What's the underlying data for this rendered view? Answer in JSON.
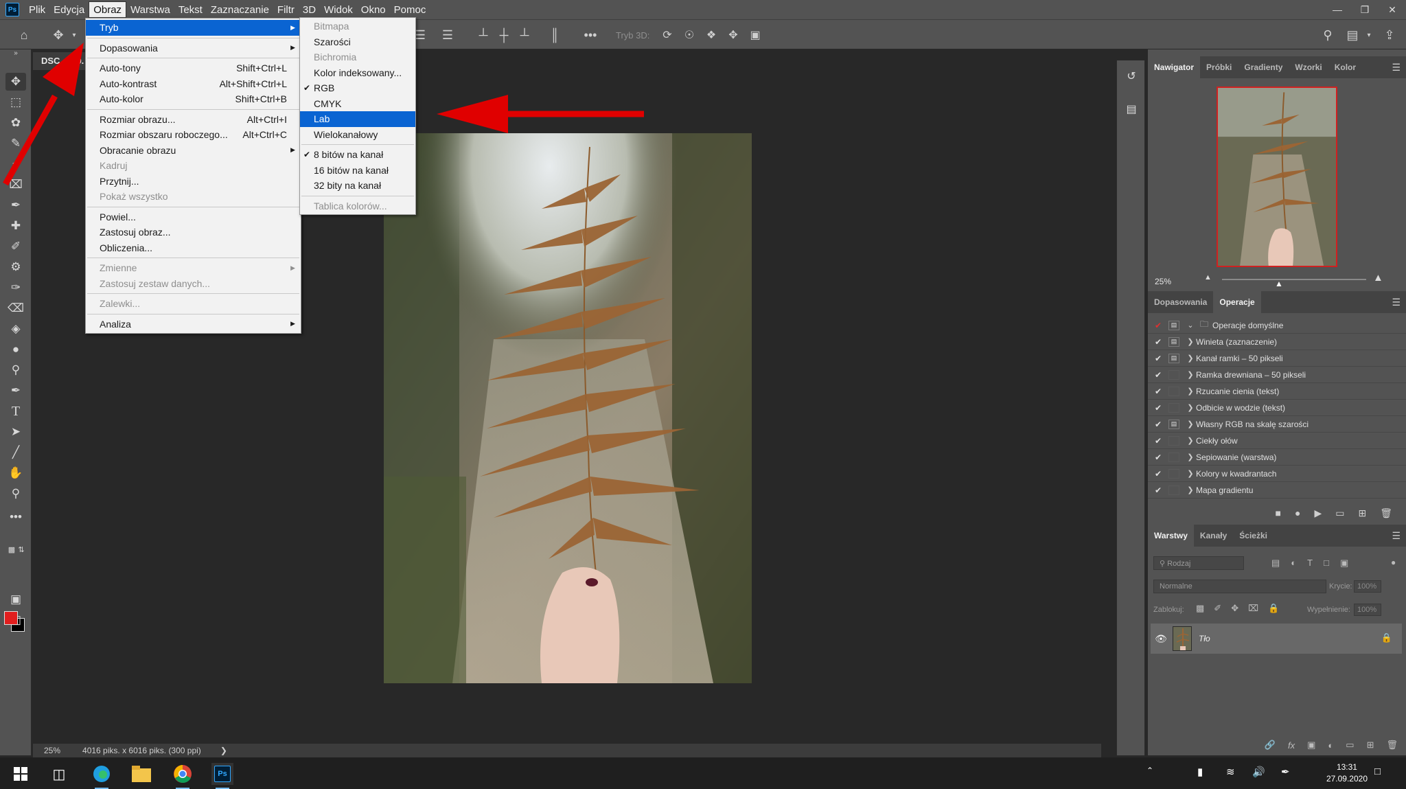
{
  "app": {
    "logo": "Ps",
    "menu": [
      "Plik",
      "Edycja",
      "Obraz",
      "Warstwa",
      "Tekst",
      "Zaznaczanie",
      "Filtr",
      "3D",
      "Widok",
      "Okno",
      "Pomoc"
    ],
    "active_menu": "Obraz"
  },
  "options_bar": {
    "mode_3d_label": "Tryb 3D:"
  },
  "document": {
    "tab_label": "DSC",
    "tab_label_tail": "9.",
    "zoom": "25%",
    "size_info": "4016 piks. x 6016 piks. (300 ppi)",
    "status_arrow": "❯"
  },
  "obraz_menu": {
    "items": [
      {
        "label": "Tryb",
        "highlight": true,
        "submenu": true
      },
      {
        "sep": true
      },
      {
        "label": "Dopasowania",
        "submenu": true
      },
      {
        "sep": true
      },
      {
        "label": "Auto-tony",
        "shortcut": "Shift+Ctrl+L"
      },
      {
        "label": "Auto-kontrast",
        "shortcut": "Alt+Shift+Ctrl+L"
      },
      {
        "label": "Auto-kolor",
        "shortcut": "Shift+Ctrl+B"
      },
      {
        "sep": true
      },
      {
        "label": "Rozmiar obrazu...",
        "shortcut": "Alt+Ctrl+I"
      },
      {
        "label": "Rozmiar obszaru roboczego...",
        "shortcut": "Alt+Ctrl+C"
      },
      {
        "label": "Obracanie obrazu",
        "submenu": true
      },
      {
        "label": "Kadruj",
        "disabled": true
      },
      {
        "label": "Przytnij..."
      },
      {
        "label": "Pokaż wszystko",
        "disabled": true
      },
      {
        "sep": true
      },
      {
        "label": "Powiel..."
      },
      {
        "label": "Zastosuj obraz..."
      },
      {
        "label": "Obliczenia..."
      },
      {
        "sep": true
      },
      {
        "label": "Zmienne",
        "disabled": true,
        "submenu": true
      },
      {
        "label": "Zastosuj zestaw danych...",
        "disabled": true
      },
      {
        "sep": true
      },
      {
        "label": "Zalewki...",
        "disabled": true
      },
      {
        "sep": true
      },
      {
        "label": "Analiza",
        "submenu": true
      }
    ]
  },
  "tryb_menu": {
    "items": [
      {
        "label": "Bitmapa",
        "disabled": true
      },
      {
        "label": "Szarości"
      },
      {
        "label": "Bichromia",
        "disabled": true
      },
      {
        "label": "Kolor indeksowany..."
      },
      {
        "label": "RGB",
        "checked": true
      },
      {
        "label": "CMYK"
      },
      {
        "label": "Lab",
        "highlight": true
      },
      {
        "label": "Wielokanałowy"
      },
      {
        "sep": true
      },
      {
        "label": "8 bitów na kanał",
        "checked": true
      },
      {
        "label": "16 bitów na kanał"
      },
      {
        "label": "32 bity na kanał"
      },
      {
        "sep": true
      },
      {
        "label": "Tablica kolorów...",
        "disabled": true
      }
    ]
  },
  "navigator": {
    "tabs": [
      "Nawigator",
      "Próbki",
      "Gradienty",
      "Wzorki",
      "Kolor"
    ],
    "zoom": "25%",
    "zoom_level": 0.25
  },
  "operations": {
    "tabs": [
      "Dopasowania",
      "Operacje"
    ],
    "items": [
      {
        "label": "Operacje domyślne",
        "folder": true,
        "box": true,
        "expanded": true
      },
      {
        "label": "Winieta (zaznaczenie)",
        "box": true
      },
      {
        "label": "Kanał ramki – 50 pikseli",
        "box": true
      },
      {
        "label": "Ramka drewniana – 50 pikseli",
        "box": false
      },
      {
        "label": "Rzucanie cienia (tekst)",
        "box": false
      },
      {
        "label": "Odbicie w wodzie (tekst)",
        "box": false
      },
      {
        "label": "Własny RGB na skalę szarości",
        "box": true
      },
      {
        "label": "Ciekły ołów",
        "box": false
      },
      {
        "label": "Sepiowanie (warstwa)",
        "box": false
      },
      {
        "label": "Kolory w kwadrantach",
        "box": false
      },
      {
        "label": "Mapa gradientu",
        "box": false
      }
    ]
  },
  "layers": {
    "tabs": [
      "Warstwy",
      "Kanały",
      "Ścieżki"
    ],
    "filter_placeholder": "Rodzaj",
    "blend_mode": "Normalne",
    "opacity_label": "Krycie:",
    "opacity_value": "100%",
    "lock_label": "Zablokuj:",
    "fill_label": "Wypełnienie:",
    "fill_value": "100%",
    "layer_name": "Tło"
  },
  "taskbar": {
    "time": "13:31",
    "date": "27.09.2020",
    "ps_label": "Ps"
  },
  "colors": {
    "foreground": "#e11e1e",
    "background": "#000000",
    "menu_highlight": "#0a64d2",
    "annotation": "#e00000"
  }
}
